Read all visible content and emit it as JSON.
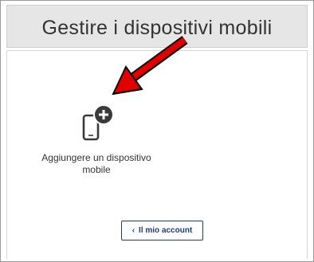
{
  "header": {
    "title": "Gestire i dispositivi mobili"
  },
  "device_tile": {
    "label_line1": "Aggiungere un dispositivo",
    "label_line2": "mobile",
    "icon": "add-mobile-device-icon"
  },
  "account_button": {
    "label": "Il mio account",
    "icon": "chevron-left-icon"
  },
  "annotation": {
    "icon": "red-arrow-icon",
    "color": "#e00000"
  },
  "colors": {
    "header_bg": "#e6e6e6",
    "button_border": "#1f3d7a",
    "icon_dark": "#3a3a3a"
  }
}
